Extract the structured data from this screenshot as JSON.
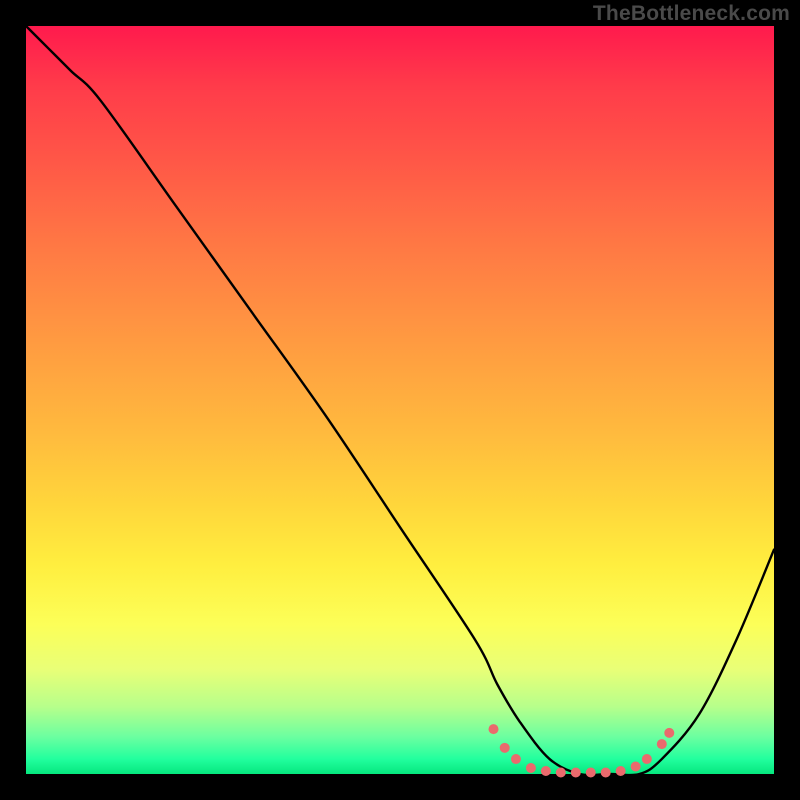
{
  "watermark": "TheBottleneck.com",
  "chart_data": {
    "type": "line",
    "title": "",
    "xlabel": "",
    "ylabel": "",
    "xlim": [
      0,
      100
    ],
    "ylim": [
      0,
      100
    ],
    "grid": false,
    "series": [
      {
        "name": "bottleneck-curve",
        "color": "#000000",
        "x": [
          0,
          3,
          6,
          10,
          20,
          30,
          40,
          50,
          60,
          63,
          66,
          70,
          74,
          78,
          82,
          85,
          90,
          95,
          100
        ],
        "y": [
          100,
          97,
          94,
          90,
          76,
          62,
          48,
          33,
          18,
          12,
          7,
          2,
          0,
          0,
          0,
          2,
          8,
          18,
          30
        ]
      }
    ],
    "markers": {
      "name": "minimum-plateau-dots",
      "color": "#ea6a6d",
      "radius": 5,
      "points": [
        {
          "x": 62.5,
          "y": 6.0
        },
        {
          "x": 64.0,
          "y": 3.5
        },
        {
          "x": 65.5,
          "y": 2.0
        },
        {
          "x": 67.5,
          "y": 0.8
        },
        {
          "x": 69.5,
          "y": 0.4
        },
        {
          "x": 71.5,
          "y": 0.2
        },
        {
          "x": 73.5,
          "y": 0.2
        },
        {
          "x": 75.5,
          "y": 0.2
        },
        {
          "x": 77.5,
          "y": 0.2
        },
        {
          "x": 79.5,
          "y": 0.4
        },
        {
          "x": 81.5,
          "y": 1.0
        },
        {
          "x": 83.0,
          "y": 2.0
        },
        {
          "x": 85.0,
          "y": 4.0
        },
        {
          "x": 86.0,
          "y": 5.5
        }
      ]
    }
  }
}
